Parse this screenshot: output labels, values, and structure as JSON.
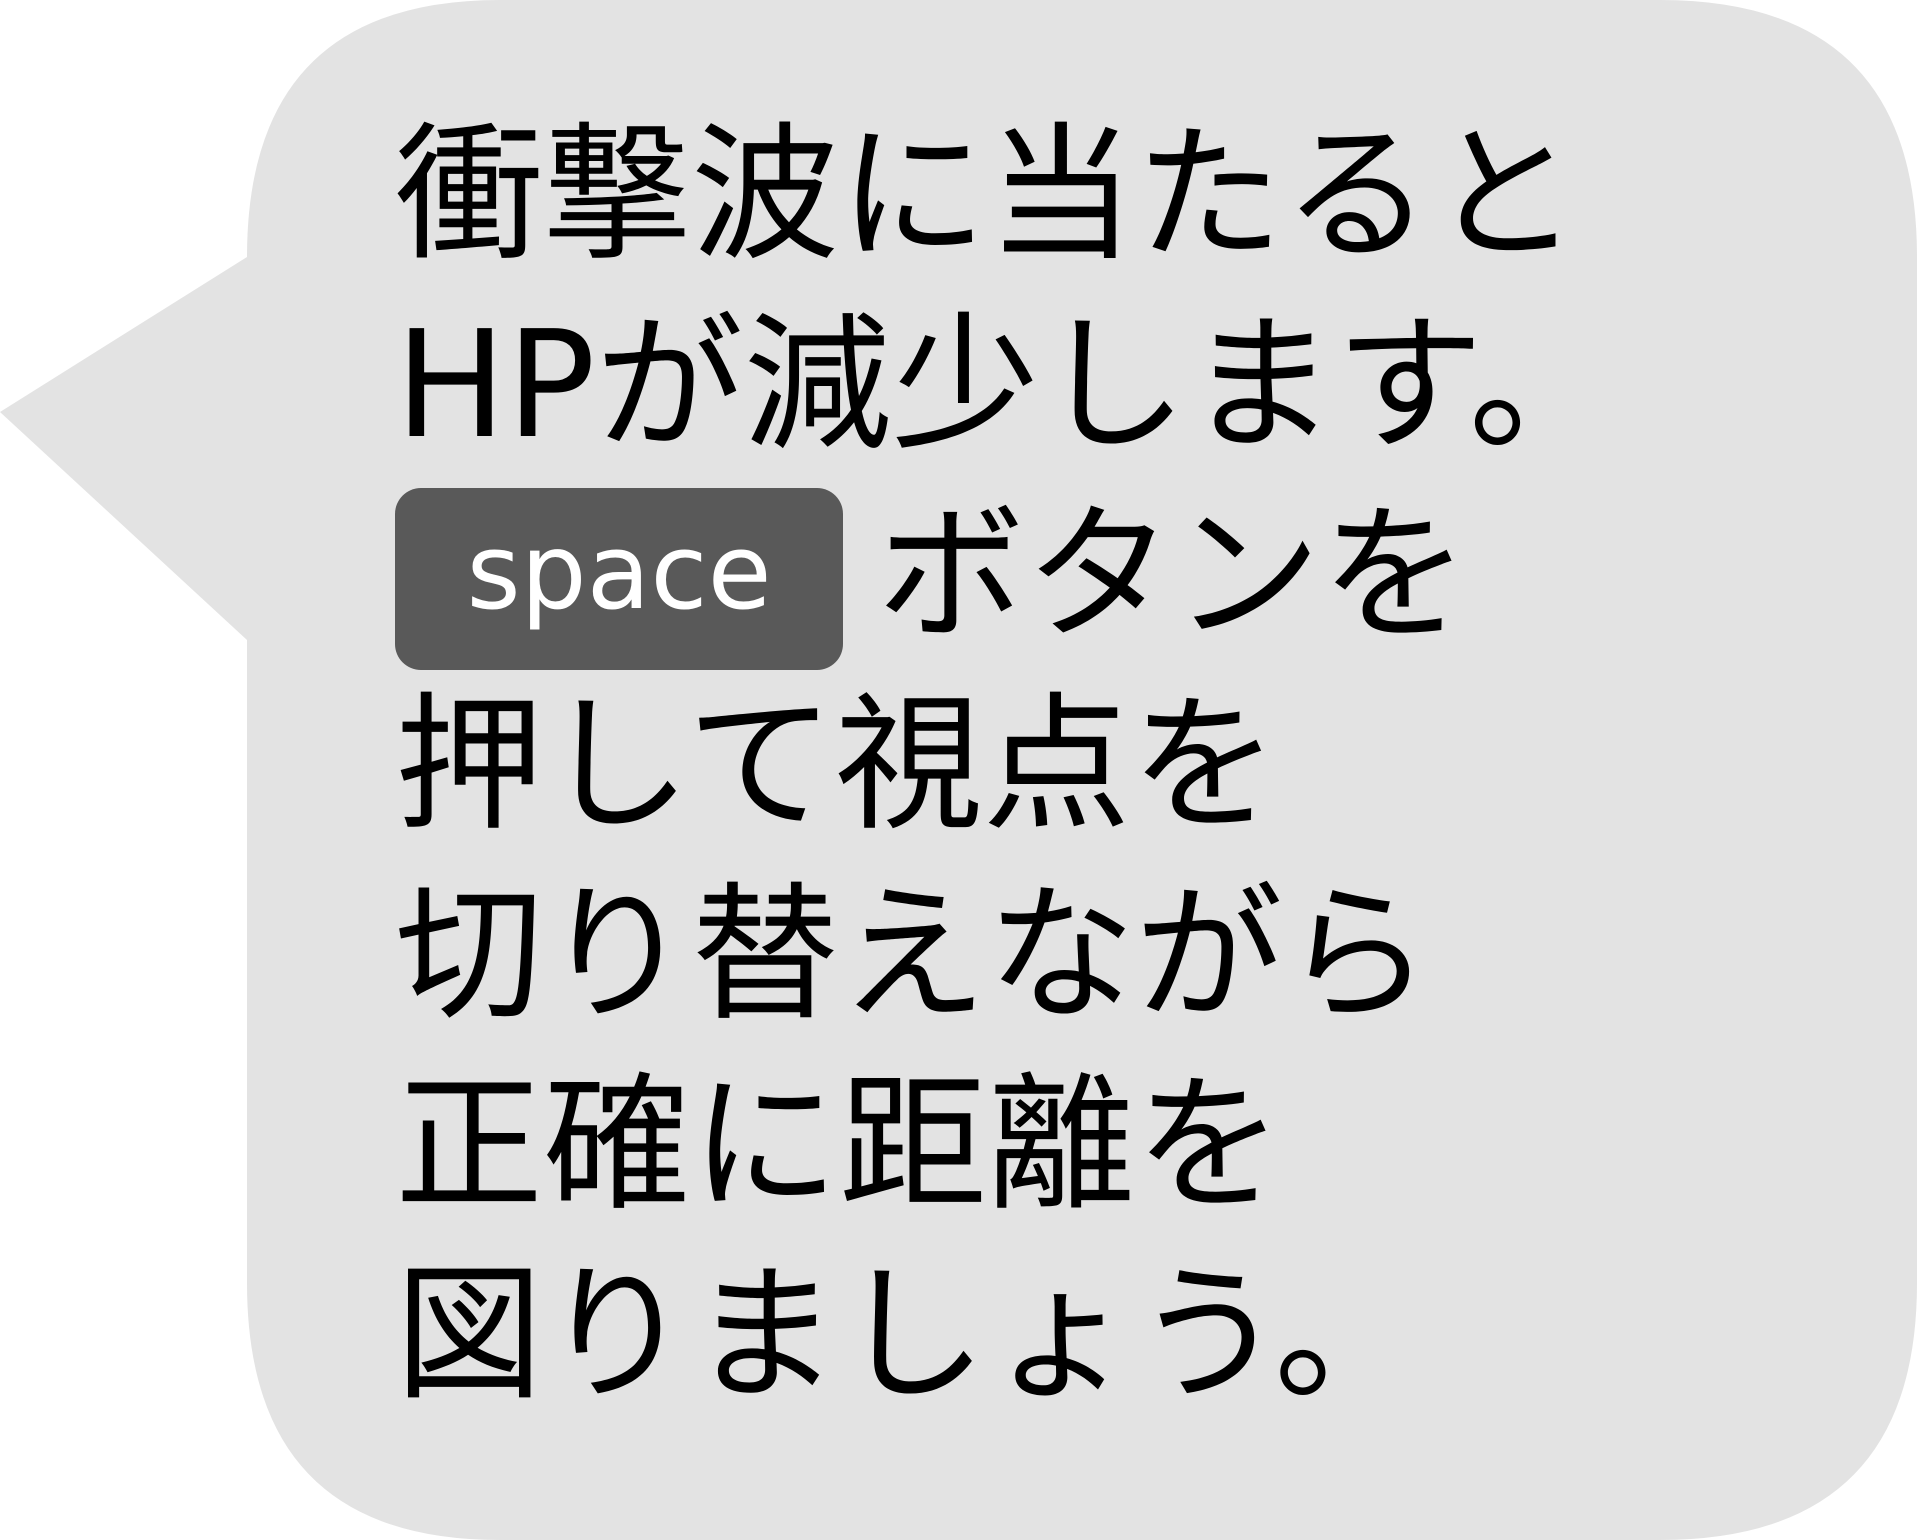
{
  "colors": {
    "bubble_fill": "#e3e3e3",
    "text": "#000000",
    "key_badge_fill": "#595959",
    "key_badge_text": "#ffffff"
  },
  "tutorial": {
    "line1": "衝撃波に当たると",
    "line2": "HPが減少します。",
    "key_label": "space",
    "line3_after_key": "ボタンを",
    "line4": "押して視点を",
    "line5": "切り替えながら",
    "line6": "正確に距離を",
    "line7": "図りましょう。"
  }
}
